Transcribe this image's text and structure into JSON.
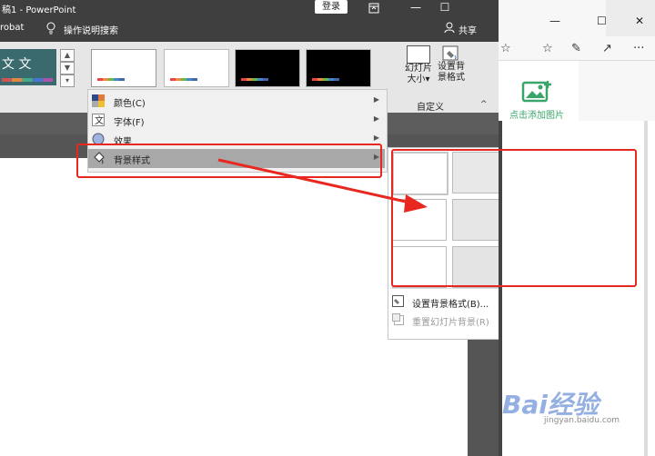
{
  "ppt": {
    "title": "稿1 - PowerPoint",
    "signin": "登录",
    "ribbon_display_icon": "ribbon-display-icon",
    "minimize": "—",
    "maximize": "☐",
    "tabs": {
      "acrobat": "robat",
      "tell_me": "操作说明搜索",
      "share": "共享"
    },
    "themes_strip_text": "文 文",
    "slide_size": {
      "line1": "幻灯片",
      "line2": "大小▾"
    },
    "format_bg": {
      "line1": "设置背",
      "line2": "景格式"
    },
    "group_label": "自定义",
    "collapse": "^"
  },
  "design_menu": {
    "items": [
      {
        "label": "颜色(C)",
        "icon": "color-palette-icon"
      },
      {
        "label": "字体(F)",
        "icon": "font-icon"
      },
      {
        "label": "效果",
        "icon": "effects-icon"
      },
      {
        "label": "背景样式",
        "icon": "background-style-icon",
        "highlighted": true
      }
    ]
  },
  "bg_styles": {
    "swatches": [
      "#ffffff",
      "#e8e8e8",
      "#44546a",
      "#000000",
      "#ffffff",
      "#e6e6e6",
      "#4f6484",
      "#404040",
      "#ffffff",
      "#e4e4e4",
      "#5a6a8a",
      "#4a4a4a"
    ],
    "format_background": "设置背景格式(B)...",
    "reset_background": "重置幻灯片背景(R)"
  },
  "browser": {
    "minimize": "—",
    "maximize": "☐",
    "close": "✕",
    "add_picture": "点击添加图片"
  },
  "watermark": {
    "logo": "Bai经验",
    "url": "jingyan.baidu.com"
  },
  "colors": {
    "annotation_red": "#e8281e",
    "accent_green": "#3aa56a"
  }
}
